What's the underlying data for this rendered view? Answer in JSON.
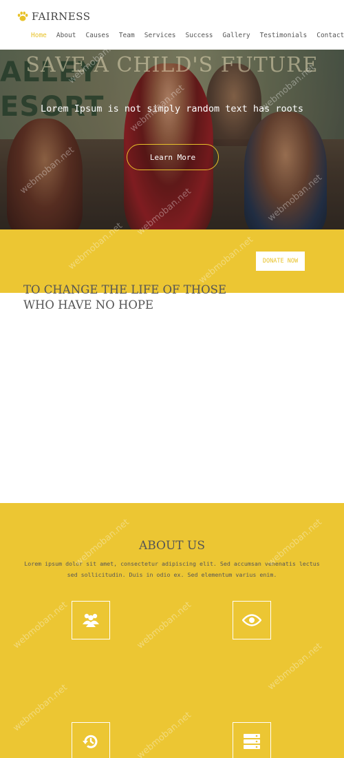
{
  "brand": {
    "name": "FAIRNESS",
    "logo_icon": "paw-icon",
    "accent": "#e8c22a"
  },
  "nav": {
    "items": [
      "Home",
      "About",
      "Causes",
      "Team",
      "Services",
      "Success",
      "Gallery",
      "Testimonials",
      "Contact"
    ],
    "active": "Home"
  },
  "hero": {
    "title": "SAVE A CHILD'S FUTURE",
    "subtitle": "Lorem Ipsum is not simply random text has roots",
    "button": "Learn More"
  },
  "strip": {
    "donate_button": "DONATE NOW",
    "mission": "TO CHANGE THE LIFE OF THOSE WHO HAVE NO HOPE"
  },
  "about": {
    "title": "ABOUT US",
    "text": "Lorem ipsum dolor sit amet, consectetur adipiscing elit. Sed accumsan venenatis lectus sed sollicitudin. Duis in odio ex. Sed elementum varius enim.",
    "features": [
      "users-icon",
      "eye-icon",
      "history-icon",
      "server-icon"
    ]
  },
  "colors": {
    "yellow": "#ecc633",
    "text": "#555555",
    "white": "#ffffff"
  },
  "watermark": "webmoban.net"
}
